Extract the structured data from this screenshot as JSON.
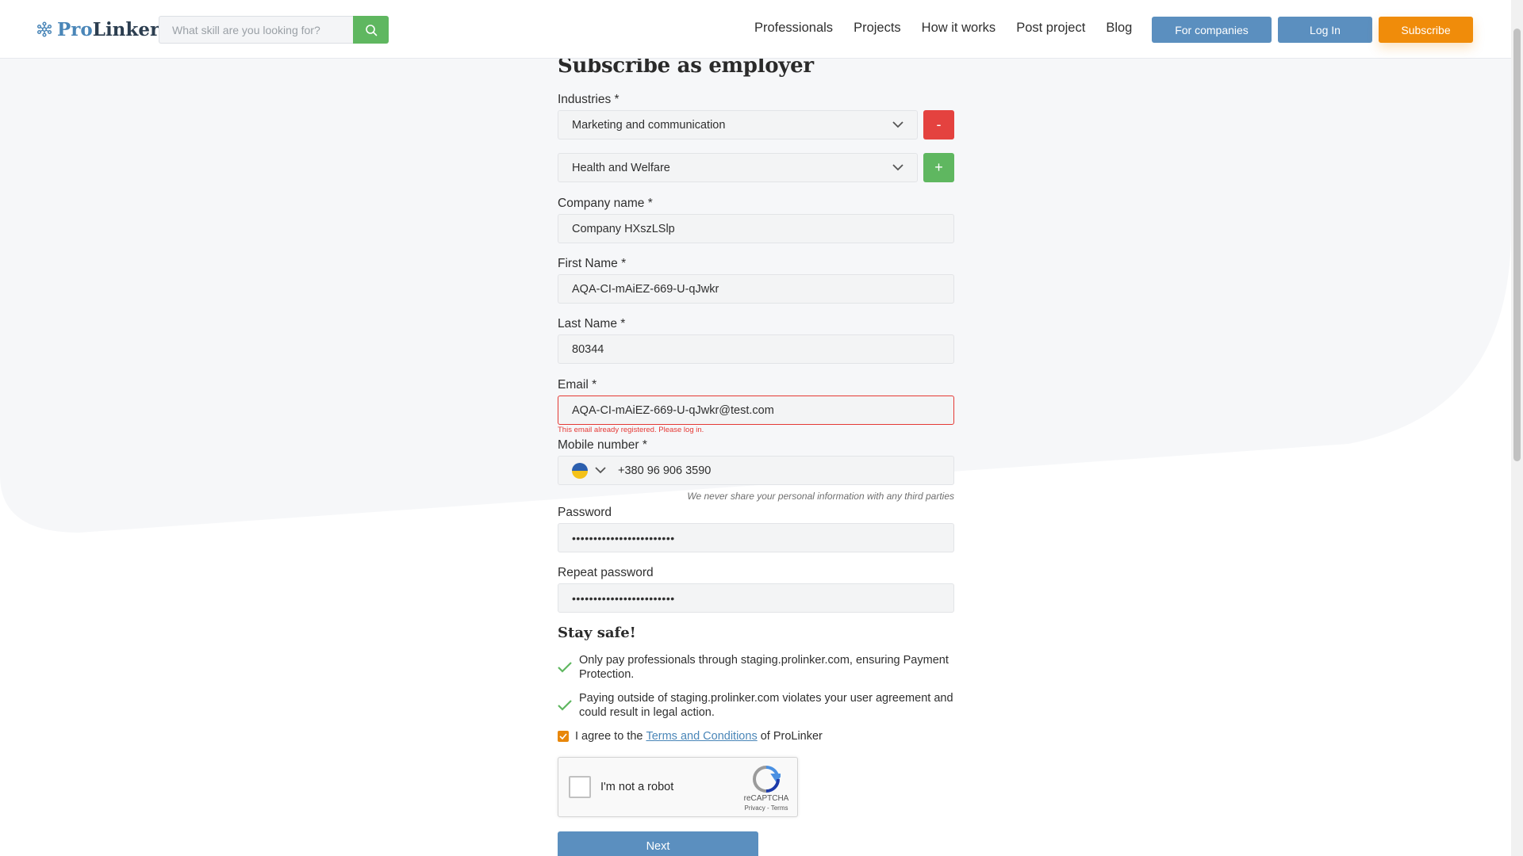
{
  "header": {
    "logo": {
      "pro": "Pro",
      "linker": "Linker"
    },
    "search": {
      "placeholder": "What skill are you looking for?"
    },
    "nav": [
      "Professionals",
      "Projects",
      "How it works",
      "Post project",
      "Blog"
    ],
    "buttons": {
      "companies": "For companies",
      "login": "Log In",
      "subscribe": "Subscribe"
    }
  },
  "form": {
    "title": "Subscribe as employer",
    "industries": {
      "label": "Industries *",
      "items": [
        {
          "value": "Marketing and communication",
          "action": "-"
        },
        {
          "value": "Health and Welfare",
          "action": "+"
        }
      ]
    },
    "company": {
      "label": "Company name *",
      "value": "Company HXszLSlp"
    },
    "first_name": {
      "label": "First Name *",
      "value": "AQA-CI-mAiEZ-669-U-qJwkr"
    },
    "last_name": {
      "label": "Last Name *",
      "value": "80344"
    },
    "email": {
      "label": "Email *",
      "value": "AQA-CI-mAiEZ-669-U-qJwkr@test.com",
      "error": "This email already registered. Please log in."
    },
    "mobile": {
      "label": "Mobile number *",
      "value": "+380 96 906 3590",
      "hint": "We never share your personal information with any third parties"
    },
    "password": {
      "label": "Password",
      "value": "••••••••••••••••••••••••"
    },
    "repeat_password": {
      "label": "Repeat password",
      "value": "••••••••••••••••••••••••"
    },
    "stay_safe": {
      "title": "Stay safe!",
      "items": [
        "Only pay professionals through staging.prolinker.com, ensuring Payment Protection.",
        "Paying outside of staging.prolinker.com violates your user agreement and could result in legal action."
      ]
    },
    "agree": {
      "prefix": "I agree to the",
      "link": "Terms and Conditions",
      "suffix": "of ProLinker"
    },
    "recaptcha": {
      "label": "I'm not a robot",
      "brand": "reCAPTCHA",
      "links": "Privacy - Terms"
    },
    "next": "Next"
  },
  "colors": {
    "accent_blue": "#5b8fbf",
    "subscribe_orange": "#f08c0a",
    "green": "#5fb760",
    "red": "#e4423f",
    "error": "#e53935"
  },
  "icons": {
    "logo": "snowflake-network-icon",
    "search": "search-icon",
    "dropdown": "chevron-down-icon",
    "check": "checkmark-icon"
  }
}
